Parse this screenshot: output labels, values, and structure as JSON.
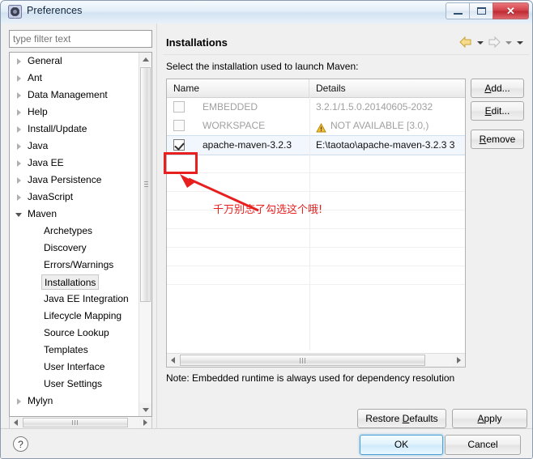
{
  "window": {
    "title": "Preferences",
    "icon": "preferences-gear-icon",
    "minimize_label": "",
    "maximize_label": "",
    "close_label": "✕"
  },
  "sidebar": {
    "filter": {
      "value": "",
      "placeholder": "type filter text"
    },
    "items": [
      {
        "label": "General",
        "level": 0,
        "state": "collapsed"
      },
      {
        "label": "Ant",
        "level": 0,
        "state": "collapsed"
      },
      {
        "label": "Data Management",
        "level": 0,
        "state": "collapsed"
      },
      {
        "label": "Help",
        "level": 0,
        "state": "collapsed"
      },
      {
        "label": "Install/Update",
        "level": 0,
        "state": "collapsed"
      },
      {
        "label": "Java",
        "level": 0,
        "state": "collapsed"
      },
      {
        "label": "Java EE",
        "level": 0,
        "state": "collapsed"
      },
      {
        "label": "Java Persistence",
        "level": 0,
        "state": "collapsed"
      },
      {
        "label": "JavaScript",
        "level": 0,
        "state": "collapsed"
      },
      {
        "label": "Maven",
        "level": 0,
        "state": "expanded"
      },
      {
        "label": "Archetypes",
        "level": 1,
        "state": "leaf"
      },
      {
        "label": "Discovery",
        "level": 1,
        "state": "leaf"
      },
      {
        "label": "Errors/Warnings",
        "level": 1,
        "state": "leaf"
      },
      {
        "label": "Installations",
        "level": 1,
        "state": "selected"
      },
      {
        "label": "Java EE Integration",
        "level": 1,
        "state": "leaf"
      },
      {
        "label": "Lifecycle Mapping",
        "level": 1,
        "state": "leaf"
      },
      {
        "label": "Source Lookup",
        "level": 1,
        "state": "leaf"
      },
      {
        "label": "Templates",
        "level": 1,
        "state": "leaf"
      },
      {
        "label": "User Interface",
        "level": 1,
        "state": "leaf"
      },
      {
        "label": "User Settings",
        "level": 1,
        "state": "leaf"
      },
      {
        "label": "Mylyn",
        "level": 0,
        "state": "collapsed"
      }
    ]
  },
  "main": {
    "title": "Installations",
    "instruction": "Select the installation used to launch Maven:",
    "nav": {
      "back_icon": "back-arrow-icon",
      "back_menu_icon": "chevron-down-icon",
      "forward_icon": "forward-arrow-icon",
      "forward_menu_icon": "chevron-down-icon",
      "view_menu_icon": "chevron-down-icon"
    },
    "table": {
      "columns": [
        "Name",
        "Details"
      ],
      "rows": [
        {
          "checked": false,
          "enabled": false,
          "name": "EMBEDDED",
          "details": "3.2.1/1.5.0.20140605-2032",
          "warning": false,
          "selected": false
        },
        {
          "checked": false,
          "enabled": false,
          "name": "WORKSPACE",
          "details": "NOT AVAILABLE [3.0,)",
          "warning": true,
          "selected": false
        },
        {
          "checked": true,
          "enabled": true,
          "name": "apache-maven-3.2.3",
          "details": "E:\\taotao\\apache-maven-3.2.3 3",
          "warning": false,
          "selected": true
        }
      ]
    },
    "buttons": {
      "add": {
        "text": "Add...",
        "mnemonic": "A"
      },
      "edit": {
        "text": "Edit...",
        "mnemonic": "E"
      },
      "remove": {
        "text": "Remove",
        "mnemonic": "R"
      }
    },
    "note": "Note: Embedded runtime is always used for dependency resolution",
    "restore_defaults": {
      "text": "Restore Defaults",
      "mnemonic": "D"
    },
    "apply": {
      "text": "Apply",
      "mnemonic": "A"
    }
  },
  "annotation": {
    "text": "千万别忘了勾选这个哦!",
    "color": "#e81f1f",
    "shape": "rectangle-and-arrow"
  },
  "footer": {
    "help_icon": "help-question-icon",
    "ok": "OK",
    "cancel": "Cancel"
  }
}
